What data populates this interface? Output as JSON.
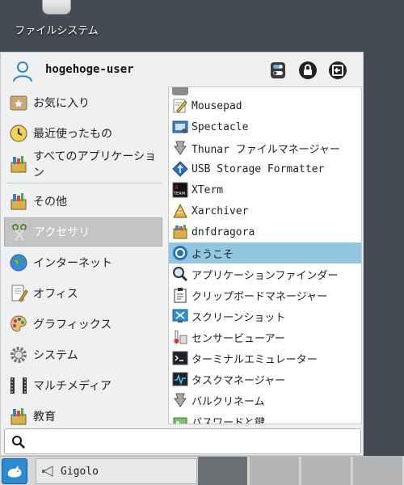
{
  "desktop": {
    "icon_label": "ファイルシステム"
  },
  "menu": {
    "user_name": "hogehoge-user",
    "categories": [
      {
        "label": "お気に入り",
        "icon": "favorites-icon"
      },
      {
        "label": "最近使ったもの",
        "icon": "recent-icon"
      },
      {
        "label": "すべてのアプリケーション",
        "icon": "all-apps-icon"
      },
      {
        "label": "その他",
        "icon": "other-icon"
      },
      {
        "label": "アクセサリ",
        "icon": "accessories-icon",
        "selected": true
      },
      {
        "label": "インターネット",
        "icon": "internet-icon"
      },
      {
        "label": "オフィス",
        "icon": "office-icon"
      },
      {
        "label": "グラフィックス",
        "icon": "graphics-icon"
      },
      {
        "label": "システム",
        "icon": "system-icon"
      },
      {
        "label": "マルチメディア",
        "icon": "multimedia-icon"
      },
      {
        "label": "教育",
        "icon": "education-icon"
      }
    ],
    "apps": [
      {
        "label": "Mousepad",
        "icon": "mousepad-icon"
      },
      {
        "label": "Spectacle",
        "icon": "spectacle-icon"
      },
      {
        "label": "Thunar ファイルマネージャー",
        "icon": "thunar-icon"
      },
      {
        "label": "USB Storage Formatter",
        "icon": "usb-formatter-icon"
      },
      {
        "label": "XTerm",
        "icon": "xterm-icon"
      },
      {
        "label": "Xarchiver",
        "icon": "xarchiver-icon"
      },
      {
        "label": "dnfdragora",
        "icon": "dnfdragora-icon"
      },
      {
        "label": "ようこそ",
        "icon": "welcome-icon",
        "selected": true
      },
      {
        "label": "アプリケーションファインダー",
        "icon": "app-finder-icon"
      },
      {
        "label": "クリップボードマネージャー",
        "icon": "clipboard-icon"
      },
      {
        "label": "スクリーンショット",
        "icon": "screenshot-icon"
      },
      {
        "label": "センサービューアー",
        "icon": "sensor-icon"
      },
      {
        "label": "ターミナルエミュレーター",
        "icon": "terminal-icon"
      },
      {
        "label": "タスクマネージャー",
        "icon": "task-manager-icon"
      },
      {
        "label": "バルクリネーム",
        "icon": "bulk-rename-icon"
      },
      {
        "label": "パスワードと鍵",
        "icon": "passwords-icon"
      }
    ],
    "search": {
      "value": "",
      "placeholder": ""
    }
  },
  "taskbar": {
    "task_label": "Gigolo"
  },
  "colors": {
    "selected_app": "#92c7e2",
    "selected_category": "#c4c4c4",
    "start_button": "#2b8bd1",
    "desktop": "#444b52"
  }
}
